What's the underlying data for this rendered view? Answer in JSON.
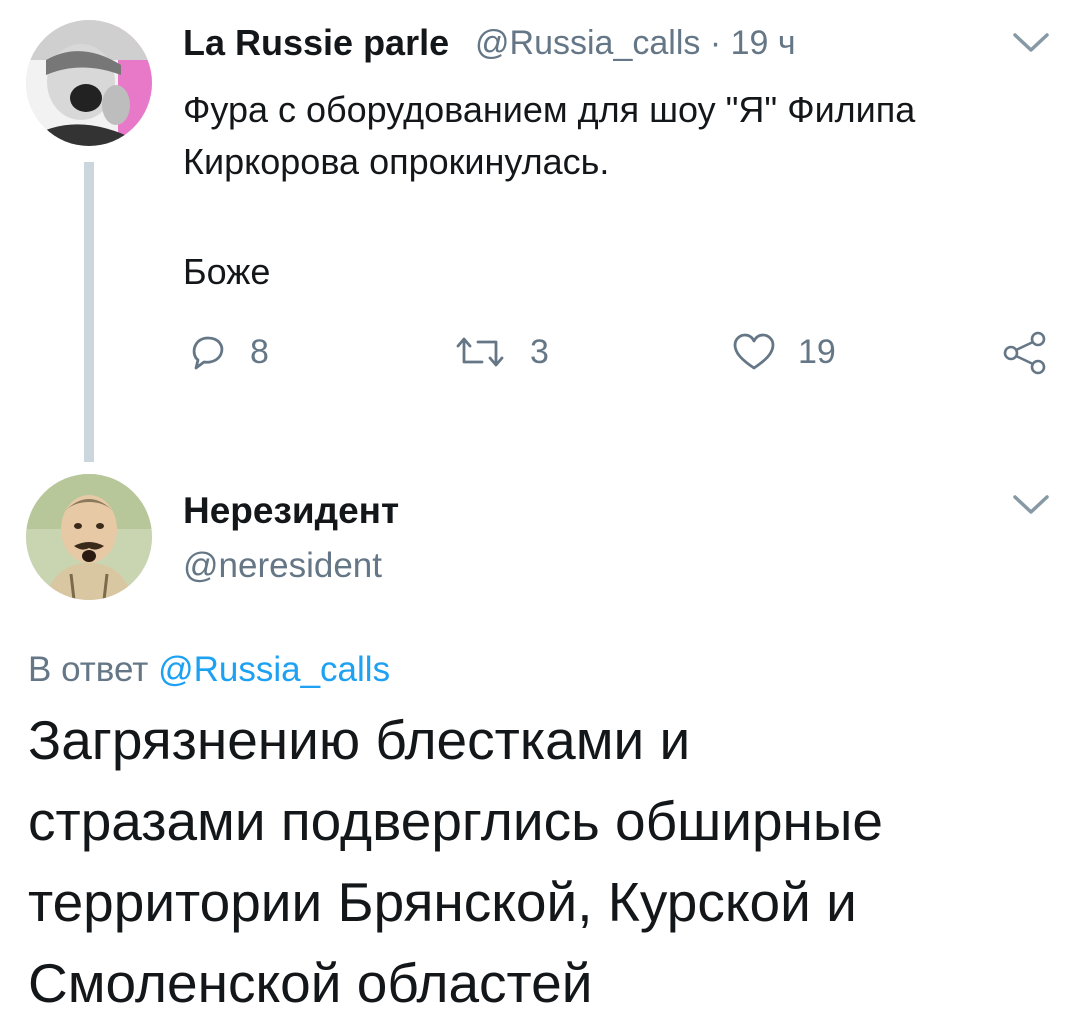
{
  "tweet1": {
    "author_name": "La Russie parle",
    "author_handle": "@Russia_calls",
    "separator": "·",
    "time": "19 ч",
    "text_line1": "Фура с оборудованием для шоу \"Я\" Филипа",
    "text_line2": "Киркорова опрокинулась.",
    "text_line3": "Боже",
    "actions": {
      "reply_count": "8",
      "retweet_count": "3",
      "like_count": "19"
    }
  },
  "tweet2": {
    "author_name": "Нерезидент",
    "author_handle": "@neresident",
    "reply_prefix": "В ответ",
    "reply_target": "@Russia_calls",
    "text_lines": [
      "Загрязнению блестками и",
      "стразами подверглись обширные",
      "территории Брянской, Курской и",
      "Смоленской областей"
    ]
  },
  "colors": {
    "text": "#14171a",
    "secondary": "#657786",
    "link": "#1da1f2",
    "thread_line": "#ccd6dd",
    "avatar1_accent": "#e879c8"
  },
  "icons": {
    "reply": "reply-icon",
    "retweet": "retweet-icon",
    "like": "heart-icon",
    "share": "share-icon",
    "menu": "chevron-down-icon"
  }
}
